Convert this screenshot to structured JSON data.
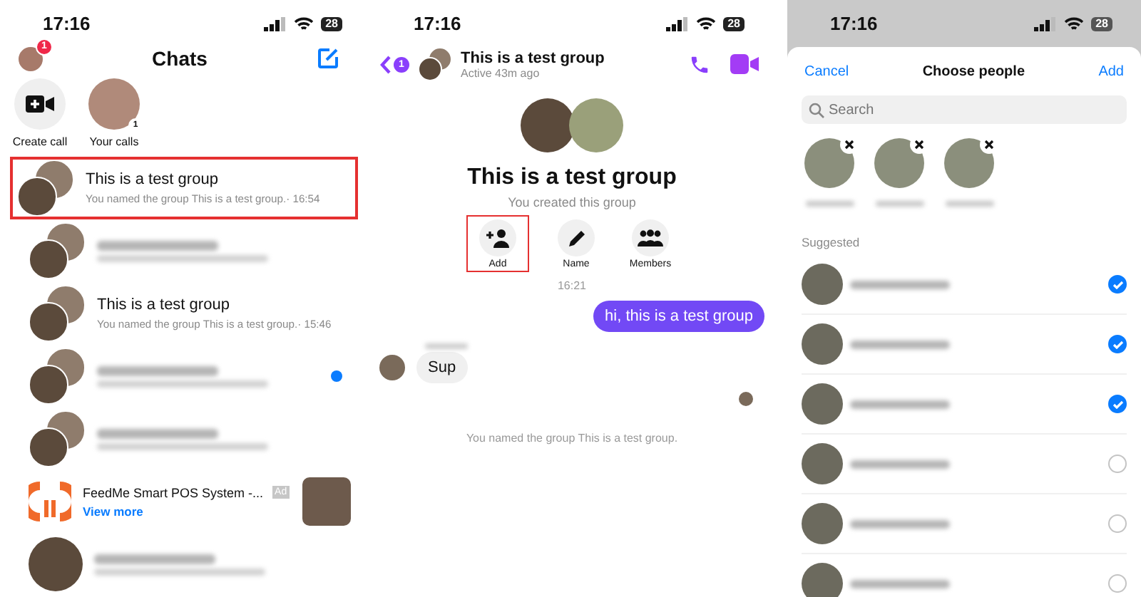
{
  "chats_screen": {
    "status_bar": {
      "time": "17:16",
      "battery": "28"
    },
    "profile_badge": "1",
    "title": "Chats",
    "shortcuts": [
      {
        "kind": "action",
        "label": "Create call"
      },
      {
        "kind": "avatar",
        "label": "Your calls",
        "badge": "1"
      }
    ],
    "chats": [
      {
        "kind": "group",
        "name": "This is a test group",
        "preview": "You named the group This is a test group.· 16:54",
        "highlighted": true,
        "unread": false
      },
      {
        "kind": "blurred",
        "highlighted": false,
        "unread": false
      },
      {
        "kind": "group",
        "name": "This is a test group",
        "preview": "You named the group This is a test group.· 15:46",
        "highlighted": false,
        "unread": false
      },
      {
        "kind": "blurred",
        "highlighted": false,
        "unread": true
      },
      {
        "kind": "blurred",
        "highlighted": false,
        "unread": false
      },
      {
        "kind": "ad",
        "name": "FeedMe Smart POS System -...",
        "tag": "Ad",
        "link": "View more",
        "highlighted": false
      },
      {
        "kind": "blurred-single",
        "highlighted": false,
        "unread": false
      }
    ]
  },
  "thread_screen": {
    "status_bar": {
      "time": "17:16",
      "battery": "28"
    },
    "back_badge": "1",
    "title": "This is a test group",
    "subtitle": "Active 43m ago",
    "group_name": "This is a test group",
    "created_note": "You created this group",
    "actions": [
      {
        "kind": "add",
        "label": "Add",
        "highlighted": true
      },
      {
        "kind": "name",
        "label": "Name",
        "highlighted": false
      },
      {
        "kind": "members",
        "label": "Members",
        "highlighted": false
      }
    ],
    "timestamp": "16:21",
    "messages": [
      {
        "kind": "outgoing",
        "text": "hi, this is a test group"
      },
      {
        "kind": "incoming",
        "text": "Sup"
      }
    ],
    "system_note": "You named the group This is a test group."
  },
  "picker_screen": {
    "status_bar": {
      "time": "17:16",
      "battery": "28"
    },
    "cancel": "Cancel",
    "title": "Choose people",
    "add": "Add",
    "search": {
      "placeholder": "Search"
    },
    "chosen": [
      {
        "kind": "person"
      },
      {
        "kind": "person"
      },
      {
        "kind": "person"
      }
    ],
    "suggested_heading": "Suggested",
    "suggested": [
      {
        "selected": true
      },
      {
        "selected": true
      },
      {
        "selected": true
      },
      {
        "selected": false
      },
      {
        "selected": false
      },
      {
        "selected": false
      }
    ]
  }
}
